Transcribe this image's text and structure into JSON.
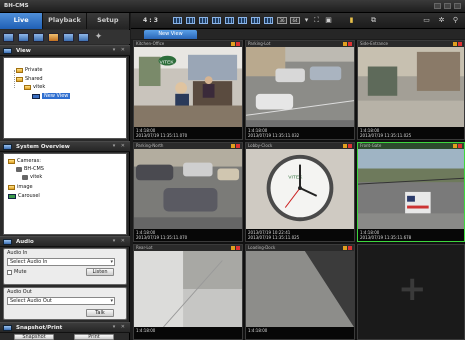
{
  "app": {
    "title": "BH-CMS"
  },
  "tabs": [
    {
      "label": "Live",
      "active": true
    },
    {
      "label": "Playback",
      "active": false
    },
    {
      "label": "Setup",
      "active": false
    }
  ],
  "view_panel": {
    "title": "View",
    "tree": [
      {
        "label": "Private"
      },
      {
        "label": "Shared"
      },
      {
        "label": "vitek"
      },
      {
        "label": "New View",
        "selected": true
      }
    ]
  },
  "system_overview": {
    "title": "System Overview",
    "tree": [
      {
        "label": "Cameras:"
      },
      {
        "label": "BH-CMS"
      },
      {
        "label": "vitek"
      },
      {
        "label": "image"
      },
      {
        "label": "Carousel"
      }
    ]
  },
  "audio": {
    "title": "Audio",
    "audio_in": {
      "label": "Audio In",
      "select_value": "Select Audio In",
      "mute_label": "Mute",
      "listen_label": "Listen"
    },
    "audio_out": {
      "label": "Audio Out",
      "select_value": "Select Audio Out",
      "talk_label": "Talk"
    }
  },
  "snapshot": {
    "title": "Snapshot/Print",
    "snapshot_label": "Snapshot",
    "print_label": "Print"
  },
  "toolbar": {
    "ratio_label": "4 : 3",
    "layout_36": "36",
    "layout_64": "64"
  },
  "view_tabs": [
    {
      "label": "New View",
      "active": true
    }
  ],
  "tiles": [
    {
      "header": "Kitchen-Office",
      "footer_line1": "1:4:18:00",
      "footer_line2": "2013/07/19 11:35:11.070",
      "highlight": false
    },
    {
      "header": "Parking-Lot",
      "footer_line1": "1:4:18:00",
      "footer_line2": "2013/07/19 11:35:11.032",
      "highlight": false
    },
    {
      "header": "Side-Entrance",
      "footer_line1": "1:4:18:00",
      "footer_line2": "2013/07/19 11:35:11.025",
      "highlight": false
    },
    {
      "header": "Parking-North",
      "footer_line1": "1:4:18:00",
      "footer_line2": "2013/07/19 11:35:11.070",
      "highlight": false
    },
    {
      "header": "Lobby-Clock",
      "footer_line1": "2013/07/19 10:22:41",
      "footer_line2": "2013/07/19 11:35:11.025",
      "highlight": false
    },
    {
      "header": "Front-Gate",
      "footer_line1": "1:4:18:00",
      "footer_line2": "2013/07/19 11:35:11.678",
      "highlight": true
    },
    {
      "header": "Rear-Lot",
      "footer_line1": "1:4:18:00",
      "footer_line2": "",
      "highlight": false
    },
    {
      "header": "Loading-Dock",
      "footer_line1": "1:4:18:00",
      "footer_line2": "",
      "highlight": false
    }
  ],
  "colors": {
    "accent": "#2f74cf",
    "highlight": "#3ed63e",
    "panel": "#2a2a2a"
  }
}
